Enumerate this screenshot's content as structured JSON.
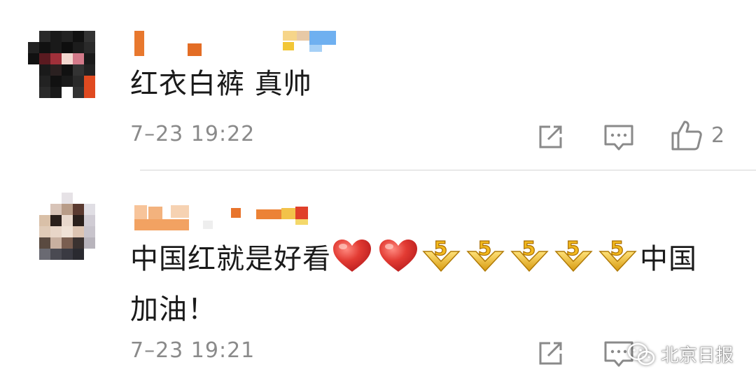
{
  "comments": [
    {
      "text": "红衣白裤 真帅",
      "time": "7–23 19:22",
      "likes": "2"
    },
    {
      "text_part1": "中国红就是好看",
      "text_part2": "中国",
      "text_line2": "加油！",
      "emoji": [
        "red-heart",
        "red-heart",
        "gold-5",
        "gold-5",
        "gold-5",
        "gold-5",
        "gold-5"
      ],
      "time": "7–23 19:21"
    }
  ],
  "watermark": "北京日报",
  "colors": {
    "text": "#1a1a1a",
    "meta": "#8a8a8a",
    "heart": "#d9322f",
    "gold": "#f2c231",
    "divider": "#e8e8e8"
  },
  "icons": [
    "share-icon",
    "comment-icon",
    "like-icon",
    "wechat-icon"
  ]
}
